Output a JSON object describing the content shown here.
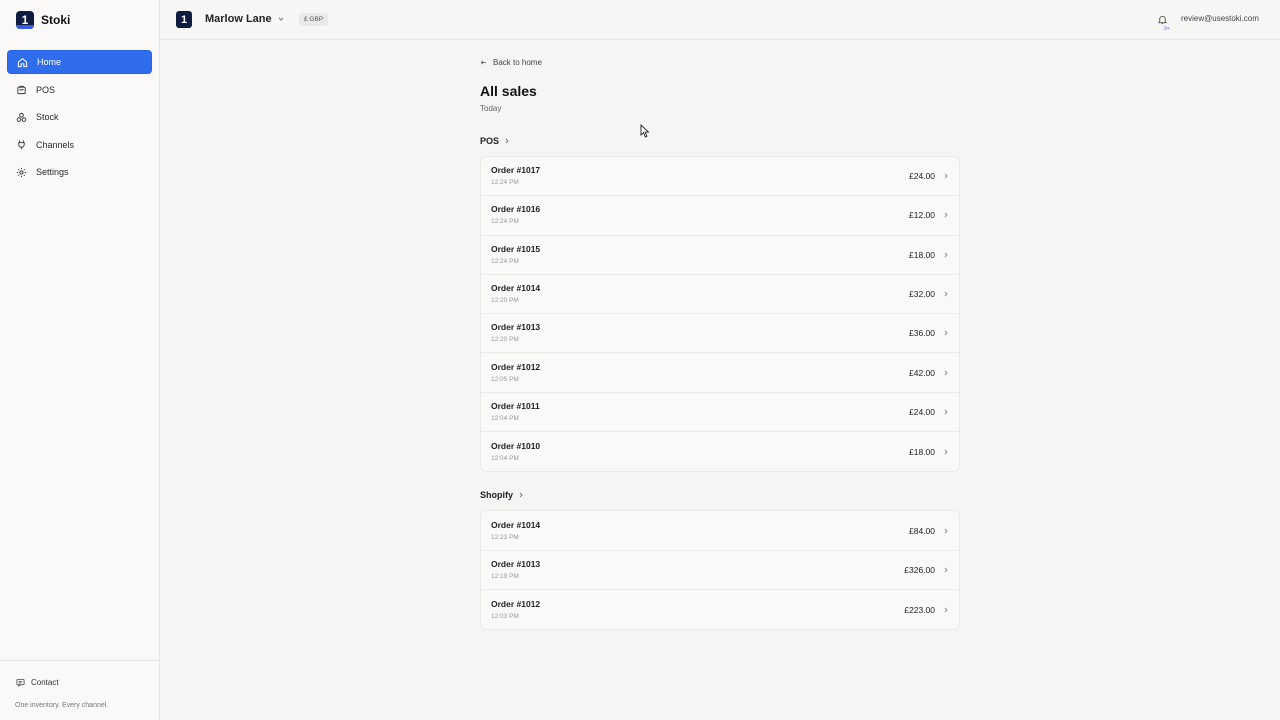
{
  "app": {
    "name": "Stoki",
    "logo_glyph": "1"
  },
  "sidebar": {
    "items": [
      {
        "label": "Home",
        "icon": "home-icon",
        "active": true
      },
      {
        "label": "POS",
        "icon": "bag-icon",
        "active": false
      },
      {
        "label": "Stock",
        "icon": "boxes-icon",
        "active": false
      },
      {
        "label": "Channels",
        "icon": "plug-icon",
        "active": false
      },
      {
        "label": "Settings",
        "icon": "gear-icon",
        "active": false
      }
    ],
    "contact_label": "Contact",
    "tagline": "One inventory. Every channel."
  },
  "header": {
    "store_name": "Marlow Lane",
    "currency": "£ GBP",
    "notification_badge": "9+",
    "user_email": "review@usestoki.com"
  },
  "page": {
    "back_label": "Back to home",
    "title": "All sales",
    "subtitle": "Today"
  },
  "sections": [
    {
      "name": "POS",
      "orders": [
        {
          "title": "Order #1017",
          "time": "12:24 PM",
          "amount": "£24.00"
        },
        {
          "title": "Order #1016",
          "time": "12:24 PM",
          "amount": "£12.00"
        },
        {
          "title": "Order #1015",
          "time": "12:24 PM",
          "amount": "£18.00"
        },
        {
          "title": "Order #1014",
          "time": "12:20 PM",
          "amount": "£32.00"
        },
        {
          "title": "Order #1013",
          "time": "12:20 PM",
          "amount": "£36.00"
        },
        {
          "title": "Order #1012",
          "time": "12:05 PM",
          "amount": "£42.00"
        },
        {
          "title": "Order #1011",
          "time": "12:04 PM",
          "amount": "£24.00"
        },
        {
          "title": "Order #1010",
          "time": "12:04 PM",
          "amount": "£18.00"
        }
      ]
    },
    {
      "name": "Shopify",
      "orders": [
        {
          "title": "Order #1014",
          "time": "12:23 PM",
          "amount": "£84.00"
        },
        {
          "title": "Order #1013",
          "time": "12:19 PM",
          "amount": "£326.00"
        },
        {
          "title": "Order #1012",
          "time": "12:03 PM",
          "amount": "£223.00"
        }
      ]
    }
  ],
  "colors": {
    "accent": "#2f6ded",
    "logo_bg": "#101c3f"
  }
}
